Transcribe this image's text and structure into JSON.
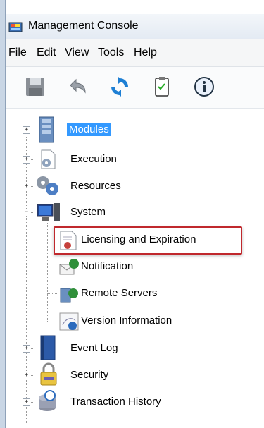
{
  "window": {
    "title": "Management Console"
  },
  "menu": [
    "File",
    "Edit",
    "View",
    "Tools",
    "Help"
  ],
  "toolbar": [
    {
      "icon": "save-icon"
    },
    {
      "icon": "undo-icon"
    },
    {
      "icon": "refresh-icon"
    },
    {
      "icon": "clipboard-icon"
    },
    {
      "icon": "info-icon"
    }
  ],
  "tree": {
    "nodes": [
      {
        "label": "Modules",
        "icon": "server-icon",
        "selected": true
      },
      {
        "label": "Execution",
        "icon": "gear-document-icon"
      },
      {
        "label": "Resources",
        "icon": "gears-icon"
      },
      {
        "label": "System",
        "icon": "computer-icon",
        "expanded": true,
        "children": [
          {
            "label": "Licensing and Expiration",
            "icon": "certificate-icon",
            "highlighted": true
          },
          {
            "label": "Notification",
            "icon": "envelope-globe-icon"
          },
          {
            "label": "Remote Servers",
            "icon": "server-globe-icon"
          },
          {
            "label": "Version Information",
            "icon": "version-info-icon"
          }
        ]
      },
      {
        "label": "Event Log",
        "icon": "book-icon"
      },
      {
        "label": "Security",
        "icon": "padlock-icon"
      },
      {
        "label": "Transaction History",
        "icon": "history-icon"
      }
    ]
  }
}
